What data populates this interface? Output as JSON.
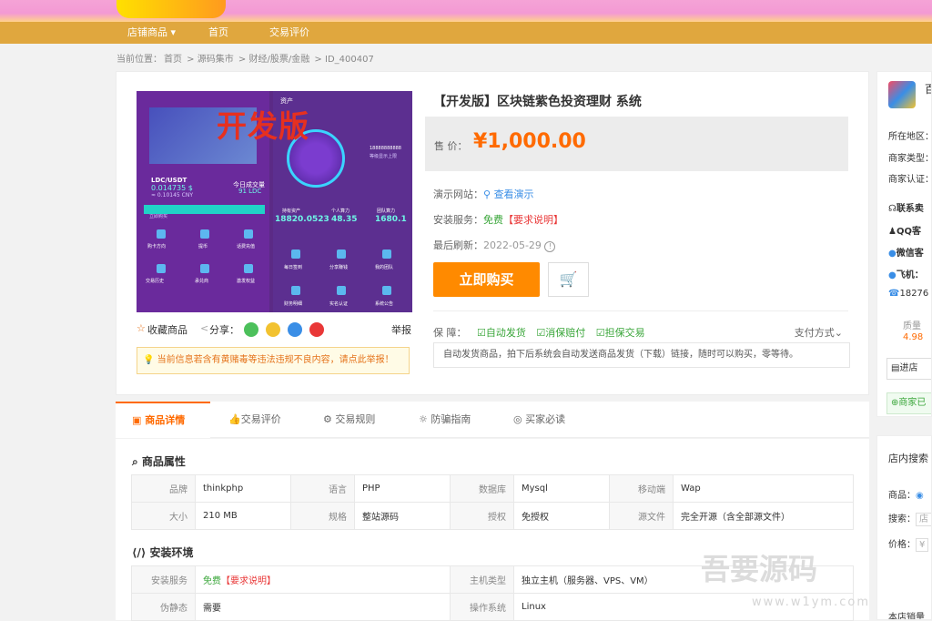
{
  "nav": {
    "items": [
      "店铺商品",
      "首页",
      "交易评价"
    ]
  },
  "breadcrumb": {
    "prefix": "当前位置：",
    "items": [
      "首页",
      "源码集市",
      "财经/股票/金融",
      "ID_400407"
    ]
  },
  "gallery": {
    "overlay": "开发版",
    "left_texts": {
      "pair": "LDC/USDT",
      "amount": "0.014735 $",
      "cny": "≈ 0.10145 CNY",
      "today_label": "今日成交量",
      "today_val": "91 LDC",
      "btn": "立即购买",
      "icons": [
        "购卡方向",
        "提币",
        "话费充值",
        "交易历史",
        "承兑商",
        "激发权益"
      ]
    },
    "right_texts": {
      "head": "资产",
      "mid_label": "18888888888",
      "mid_sub": "等级显示上限",
      "stats_labels": [
        "持有资产",
        "个人算力",
        "团队算力"
      ],
      "stats_vals": [
        "18820.0523",
        "48.35",
        "1680.1"
      ],
      "icons": [
        "每日签到",
        "分享赚钱",
        "我的团队",
        "财务明细",
        "实名认证",
        "系统公告"
      ]
    }
  },
  "actions": {
    "favorite": "收藏商品",
    "share": "分享：",
    "report": "举报"
  },
  "notice": "当前信息若含有黄赌毒等违法违规不良内容，请点此举报！",
  "product": {
    "title": "【开发版】区块链紫色投资理财 系统",
    "price_label": "售 价：",
    "price": "¥1,000.00",
    "demo_label": "演示网站：",
    "demo_link": "查看演示",
    "install_label": "安装服务：",
    "install_free": "免费",
    "install_req": "【要求说明】",
    "refresh_label": "最后刷新：",
    "refresh_date": "2022-05-29",
    "buy_label": "立即购买",
    "guarantee_label": "保 障：",
    "guarantees": [
      "自动发货",
      "消保赔付",
      "担保交易"
    ],
    "payway": "支付方式",
    "guarantee_desc": "自动发货商品，拍下后系统会自动发送商品发货（下载）链接，随时可以购买，零等待。"
  },
  "tabs": [
    "商品详情",
    "交易评价",
    "交易规则",
    "防骗指南",
    "买家必读"
  ],
  "attributes": {
    "title": "商品属性",
    "rows": [
      [
        [
          "品牌",
          "thinkphp"
        ],
        [
          "语言",
          "PHP"
        ],
        [
          "数据库",
          "Mysql"
        ],
        [
          "移动端",
          "Wap"
        ]
      ],
      [
        [
          "大小",
          "210 MB"
        ],
        [
          "规格",
          "整站源码"
        ],
        [
          "授权",
          "免授权"
        ],
        [
          "源文件",
          "完全开源（含全部源文件）"
        ]
      ]
    ]
  },
  "env": {
    "title": "安装环境",
    "rows": [
      {
        "k1": "安装服务",
        "v1_free": "免费",
        "v1_req": "【要求说明】",
        "k2": "主机类型",
        "v2": "独立主机（服务器、VPS、VM）"
      },
      {
        "k1": "伪静态",
        "v1": "需要",
        "k2": "操作系统",
        "v2": "Linux"
      }
    ]
  },
  "side": {
    "shop_name": "百",
    "region": "所在地区：",
    "type": "商家类型：",
    "cert": "商家认证：",
    "contact": "联系卖",
    "qq": "QQ客",
    "wechat": "微信客",
    "feiji": "飞机：",
    "phone": "18276",
    "quality_label": "质量",
    "quality_val": "4.98",
    "enter_shop": "进店",
    "shop_tag": "商家已"
  },
  "side2": {
    "title": "店内搜索",
    "goods": "商品：",
    "search": "搜索：",
    "search_ph": "店",
    "price": "价格：",
    "price_ph": "¥",
    "sold": "本店销量"
  },
  "watermark": {
    "text": "吾要源码",
    "url": "www.w1ym.com"
  },
  "colors": {
    "accent": "#ff6a00",
    "nav": "#e0a73e",
    "green": "#3aa63a",
    "red": "#e93737",
    "link": "#3a8ee6"
  }
}
